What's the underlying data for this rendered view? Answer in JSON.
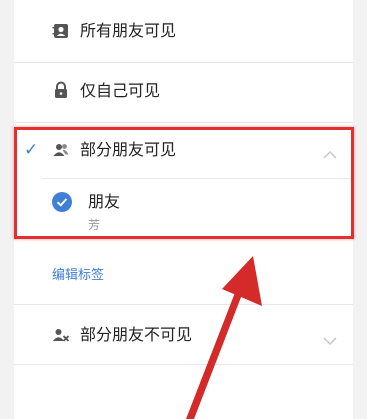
{
  "options": {
    "all_friends": {
      "label": "所有朋友可见",
      "icon": "contacts-card-icon"
    },
    "only_self": {
      "label": "仅自己可见",
      "icon": "lock-icon"
    },
    "partial_visible": {
      "label": "部分朋友可见",
      "icon": "group-icon",
      "selected": true,
      "expanded": true
    },
    "partial_hidden": {
      "label": "部分朋友不可见",
      "icon": "group-exclude-icon",
      "expanded": false
    }
  },
  "tag_list": [
    {
      "name": "朋友",
      "members": "芳",
      "checked": true
    }
  ],
  "edit_tags_link": "编辑标签",
  "colors": {
    "accent": "#3f7fd6",
    "annotation_red": "#e03030"
  }
}
